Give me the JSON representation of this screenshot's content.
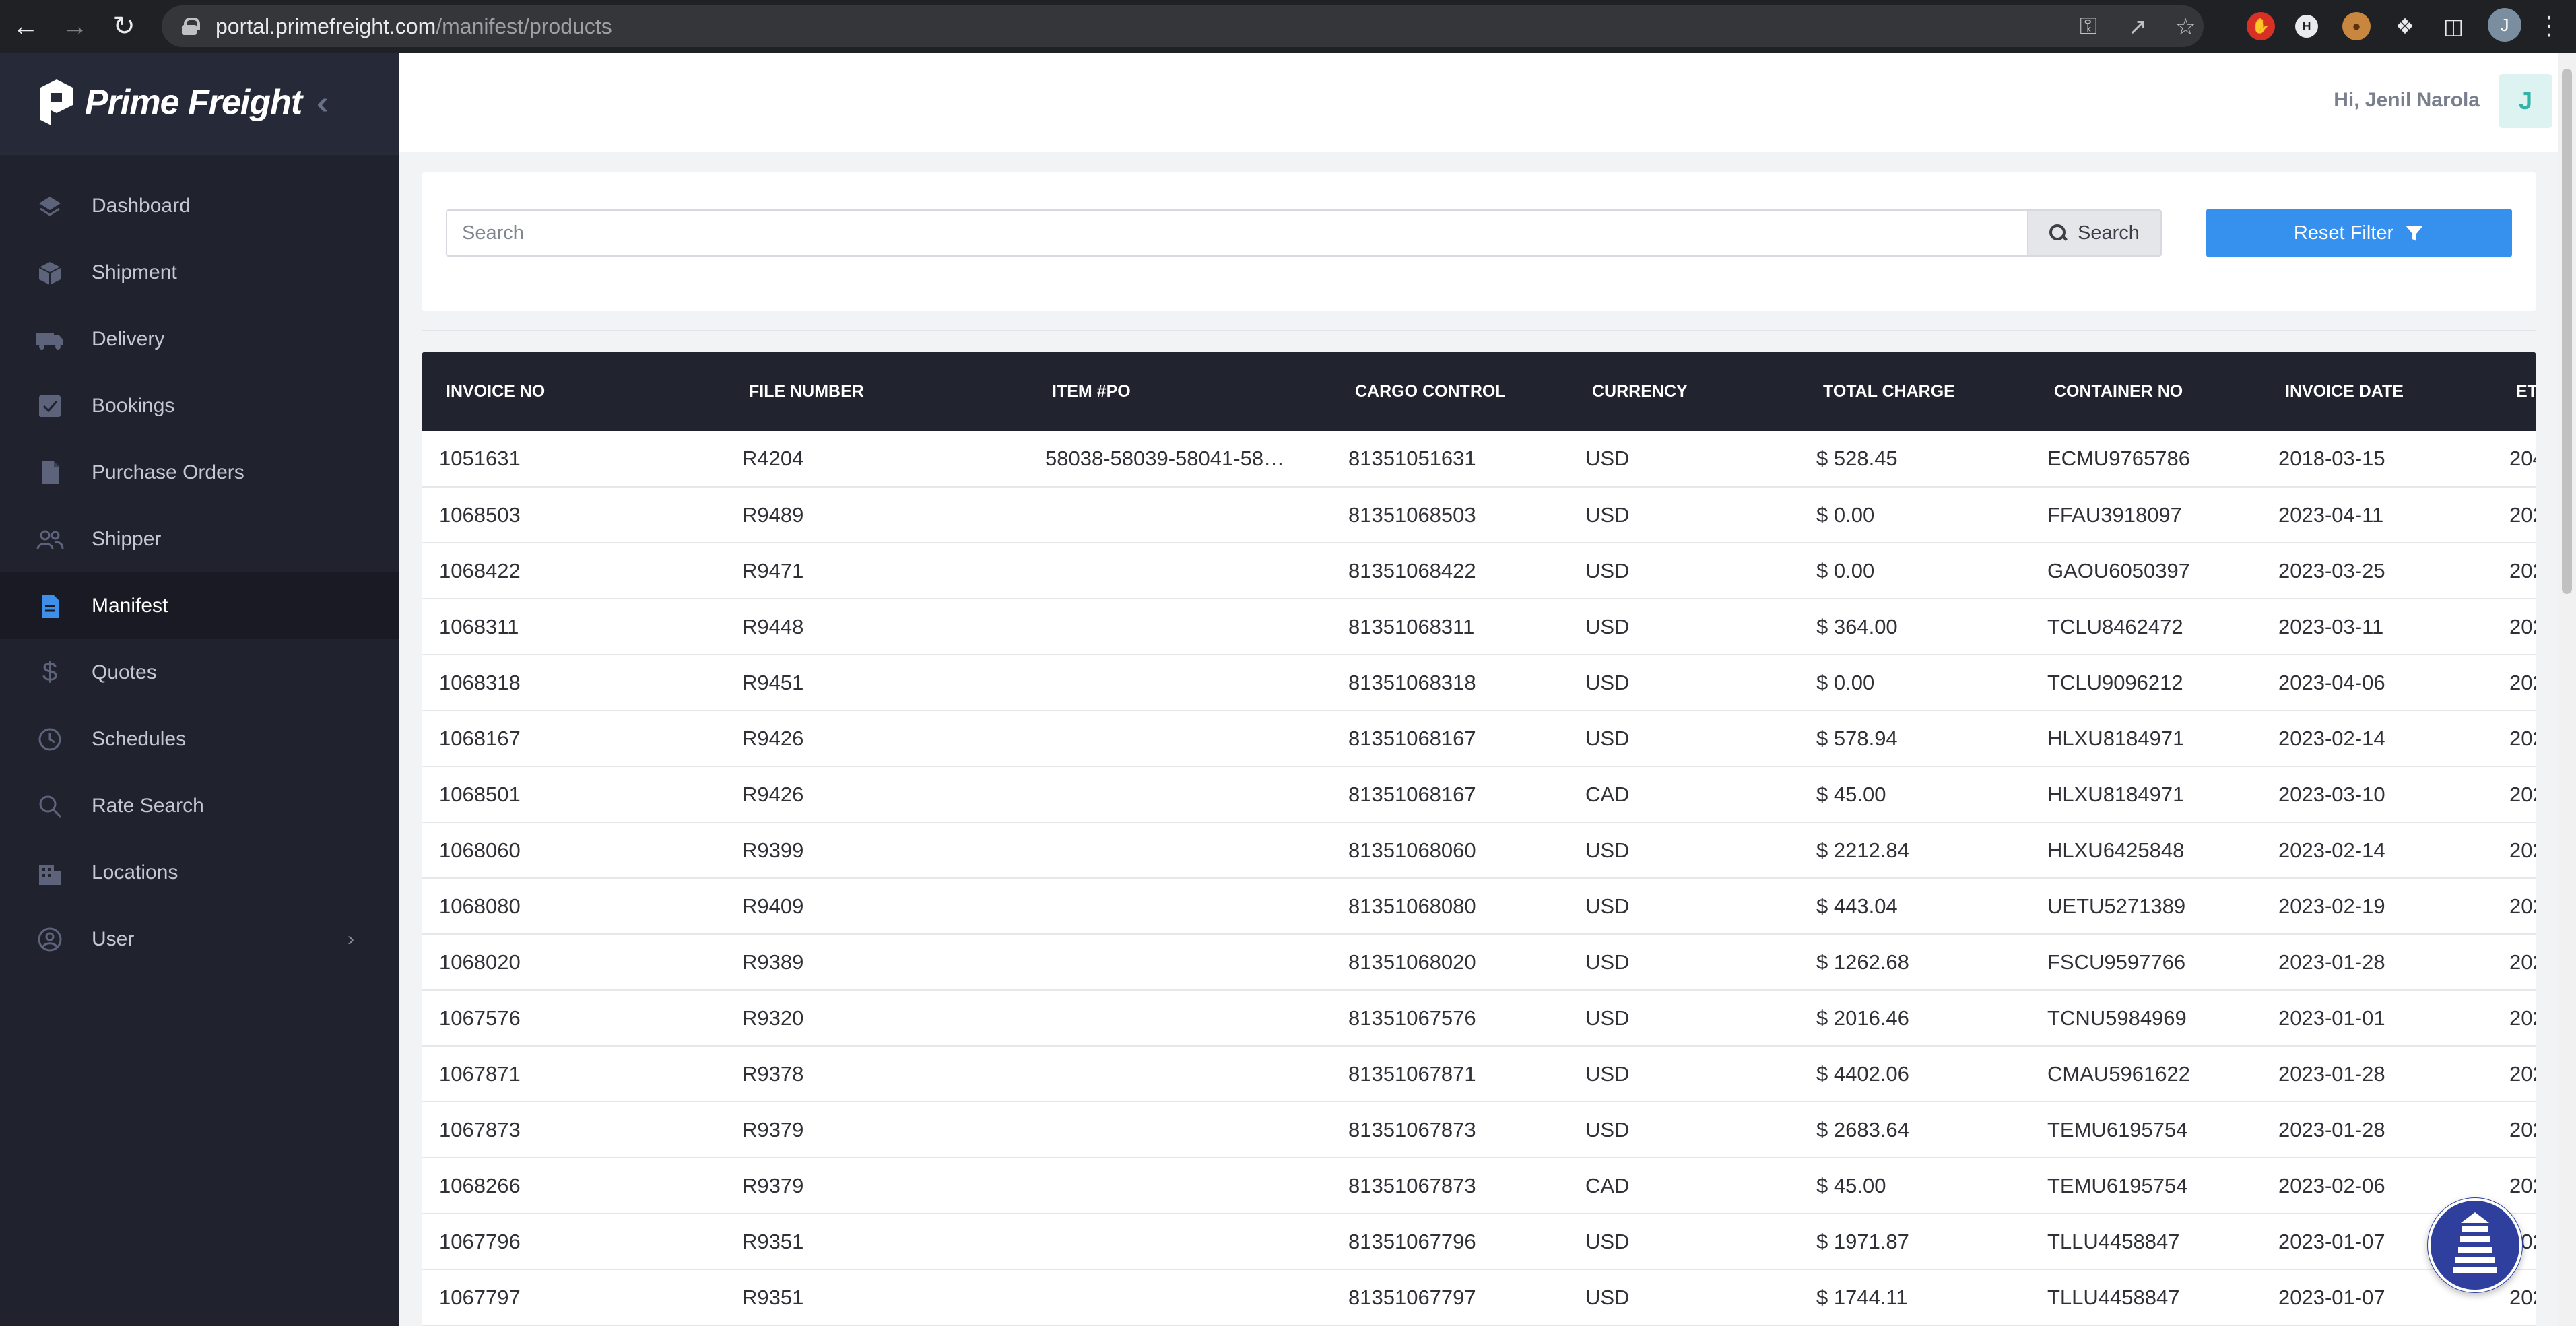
{
  "browser": {
    "url_host": "portal.primefreight.com",
    "url_path": "/manifest/products",
    "profile_initial": "J"
  },
  "sidebar": {
    "brand": "Prime Freight",
    "items": [
      {
        "label": "Dashboard",
        "icon": "layers-icon"
      },
      {
        "label": "Shipment",
        "icon": "box-icon"
      },
      {
        "label": "Delivery",
        "icon": "truck-icon"
      },
      {
        "label": "Bookings",
        "icon": "checkbox-icon"
      },
      {
        "label": "Purchase Orders",
        "icon": "document-icon"
      },
      {
        "label": "Shipper",
        "icon": "users-icon"
      },
      {
        "label": "Manifest",
        "icon": "file-text-icon",
        "active": true
      },
      {
        "label": "Quotes",
        "icon": "dollar-icon"
      },
      {
        "label": "Schedules",
        "icon": "clock-icon"
      },
      {
        "label": "Rate Search",
        "icon": "search-icon"
      },
      {
        "label": "Locations",
        "icon": "building-icon"
      },
      {
        "label": "User",
        "icon": "user-circle-icon"
      }
    ]
  },
  "header": {
    "greeting": "Hi, Jenil Narola",
    "user_initial": "J"
  },
  "filter": {
    "search_placeholder": "Search",
    "search_button": "Search",
    "reset_button": "Reset Filter"
  },
  "table": {
    "columns": [
      "INVOICE NO",
      "FILE NUMBER",
      "ITEM #PO",
      "CARGO CONTROL",
      "CURRENCY",
      "TOTAL CHARGE",
      "CONTAINER NO",
      "INVOICE DATE",
      "ETD"
    ],
    "rows": [
      [
        "1051631",
        "R4204",
        "58038-58039-58041-58…",
        "81351051631",
        "USD",
        "$ 528.45",
        "ECMU9765786",
        "2018-03-15",
        "204"
      ],
      [
        "1068503",
        "R9489",
        "",
        "81351068503",
        "USD",
        "$ 0.00",
        "FFAU3918097",
        "2023-04-11",
        "202"
      ],
      [
        "1068422",
        "R9471",
        "",
        "81351068422",
        "USD",
        "$ 0.00",
        "GAOU6050397",
        "2023-03-25",
        "202"
      ],
      [
        "1068311",
        "R9448",
        "",
        "81351068311",
        "USD",
        "$ 364.00",
        "TCLU8462472",
        "2023-03-11",
        "202"
      ],
      [
        "1068318",
        "R9451",
        "",
        "81351068318",
        "USD",
        "$ 0.00",
        "TCLU9096212",
        "2023-04-06",
        "202"
      ],
      [
        "1068167",
        "R9426",
        "",
        "81351068167",
        "USD",
        "$ 578.94",
        "HLXU8184971",
        "2023-02-14",
        "202"
      ],
      [
        "1068501",
        "R9426",
        "",
        "81351068167",
        "CAD",
        "$ 45.00",
        "HLXU8184971",
        "2023-03-10",
        "202"
      ],
      [
        "1068060",
        "R9399",
        "",
        "81351068060",
        "USD",
        "$ 2212.84",
        "HLXU6425848",
        "2023-02-14",
        "202"
      ],
      [
        "1068080",
        "R9409",
        "",
        "81351068080",
        "USD",
        "$ 443.04",
        "UETU5271389",
        "2023-02-19",
        "202"
      ],
      [
        "1068020",
        "R9389",
        "",
        "81351068020",
        "USD",
        "$ 1262.68",
        "FSCU9597766",
        "2023-01-28",
        "202"
      ],
      [
        "1067576",
        "R9320",
        "",
        "81351067576",
        "USD",
        "$ 2016.46",
        "TCNU5984969",
        "2023-01-01",
        "202"
      ],
      [
        "1067871",
        "R9378",
        "",
        "81351067871",
        "USD",
        "$ 4402.06",
        "CMAU5961622",
        "2023-01-28",
        "202"
      ],
      [
        "1067873",
        "R9379",
        "",
        "81351067873",
        "USD",
        "$ 2683.64",
        "TEMU6195754",
        "2023-01-28",
        "202"
      ],
      [
        "1068266",
        "R9379",
        "",
        "81351067873",
        "CAD",
        "$ 45.00",
        "TEMU6195754",
        "2023-02-06",
        "202"
      ],
      [
        "1067796",
        "R9351",
        "",
        "81351067796",
        "USD",
        "$ 1971.87",
        "TLLU4458847",
        "2023-01-07",
        "202"
      ],
      [
        "1067797",
        "R9351",
        "",
        "81351067797",
        "USD",
        "$ 1744.11",
        "TLLU4458847",
        "2023-01-07",
        "202"
      ]
    ]
  },
  "colors": {
    "accent": "#3590ee",
    "sidebar_bg": "#20222e",
    "table_header_bg": "#21232f",
    "badge_bg": "#dcf3f2",
    "badge_text": "#33b3a8"
  }
}
